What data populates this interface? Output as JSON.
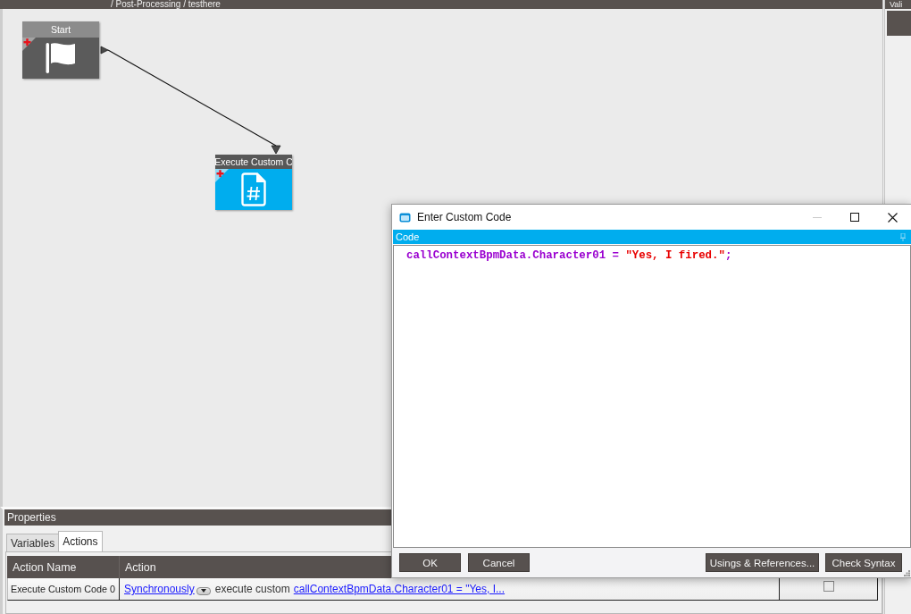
{
  "breadcrumb": "/ Post-Processing / testhere",
  "side_panel": {
    "title": "Vali"
  },
  "canvas": {
    "nodes": [
      {
        "kind": "start",
        "title": "Start"
      },
      {
        "kind": "custom_code",
        "title": "Execute Custom C"
      }
    ]
  },
  "properties": {
    "title": "Properties",
    "tabs": [
      {
        "label": "Variables",
        "selected": false
      },
      {
        "label": "Actions",
        "selected": true
      }
    ],
    "table": {
      "columns": [
        "Action Name",
        "Action"
      ],
      "rows": [
        {
          "action_name": "Execute Custom Code 0",
          "mode": "Synchronously",
          "text": "execute custom",
          "code": "callContextBpmData.Character01 = \"Yes, I...",
          "checked": false
        }
      ]
    }
  },
  "dialog": {
    "title": "Enter Custom Code",
    "section": "Code",
    "code_lines": [
      [
        {
          "kind": "identifier",
          "text": "callContextBpmData.Character01 = "
        },
        {
          "kind": "string",
          "text": "\"Yes, I fired.\""
        },
        {
          "kind": "identifier",
          "text": ";"
        }
      ]
    ],
    "left_buttons": [
      "OK",
      "Cancel"
    ],
    "right_buttons": [
      "Usings & References...",
      "Check Syntax"
    ]
  }
}
